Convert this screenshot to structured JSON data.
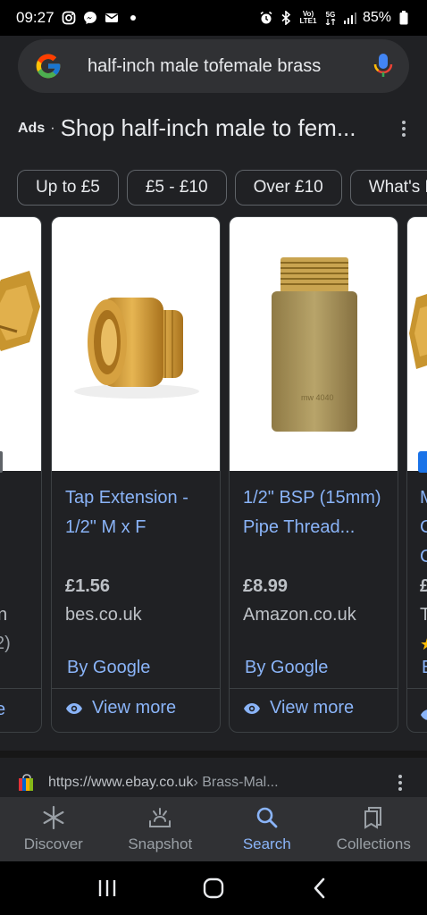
{
  "status_bar": {
    "time": "09:27",
    "battery_percent": "85%",
    "network_label_top": "Vo)",
    "network_label_bottom": "LTE1",
    "network_type": "5G"
  },
  "search": {
    "query": "half-inch male tofemale brass"
  },
  "ads": {
    "label": "Ads",
    "separator": "·",
    "title": "Shop half-inch male to fem..."
  },
  "chips": [
    {
      "label": "Up to £5"
    },
    {
      "label": "£5 - £10"
    },
    {
      "label": "Over £10"
    },
    {
      "label": "What's N"
    }
  ],
  "products": [
    {
      "title": "Tap Extension - 1/2\" M x F",
      "price": "£1.56",
      "store": "bes.co.uk",
      "by_google": "By Google",
      "view_more": "View more"
    },
    {
      "title": "1/2\" BSP (15mm) Pipe Thread...",
      "price": "£8.99",
      "store": "Amazon.co.uk",
      "by_google": "By Google",
      "view_more": "View more"
    }
  ],
  "partial_left_card": {
    "store_fragment": "n",
    "reviews_fragment": "2)",
    "view_fragment": "e"
  },
  "partial_right_card": {
    "title_fragment": "M\nC\nC",
    "price_fragment": "£",
    "store_fragment": "T",
    "google_fragment": "E"
  },
  "result": {
    "url": "https://www.ebay.co.uk",
    "path": " › Brass-Mal..."
  },
  "bottom_nav": {
    "discover": "Discover",
    "snapshot": "Snapshot",
    "search": "Search",
    "collections": "Collections"
  },
  "colors": {
    "background": "#202124",
    "link_blue": "#8ab4f8",
    "text": "#e8eaed"
  }
}
